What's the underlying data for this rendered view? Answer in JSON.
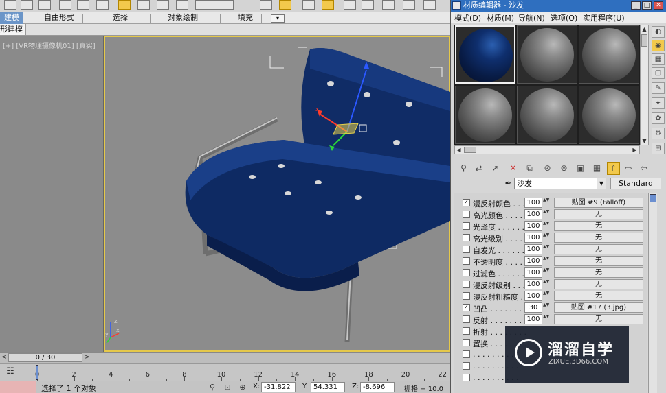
{
  "ribbon": {
    "tabs": [
      "建模",
      "自由形式",
      "选择",
      "对象绘制",
      "填充"
    ],
    "active_tab": "建模",
    "subtab": "形建模"
  },
  "viewport": {
    "label": "[+] [VR物理摄像机01] [真实]",
    "axis_labels": {
      "x": "x",
      "y": "y",
      "z": "z"
    }
  },
  "timeline": {
    "slider_text": "0 / 30",
    "prev_arrow": "<",
    "next_arrow": ">",
    "ticks": [
      0,
      2,
      4,
      6,
      8,
      10,
      12,
      14,
      16,
      18,
      20,
      22
    ]
  },
  "status": {
    "message": "选择了 1 个对象",
    "x_label": "X:",
    "x_value": "-31.822",
    "y_label": "Y:",
    "y_value": "54.331",
    "z_label": "Z:",
    "z_value": "-8.696",
    "grid": "栅格 = 10.0"
  },
  "material_editor": {
    "title": "材质编辑器 - 沙发",
    "window_buttons": {
      "minimize": "_",
      "maximize": "□",
      "close": "✕"
    },
    "menu": [
      "模式(D)",
      "材质(M)",
      "导航(N)",
      "选项(O)",
      "实用程序(U)"
    ],
    "material_name": "沙发",
    "material_type": "Standard",
    "maps": [
      {
        "checked": true,
        "label": "漫反射颜色 . . . .",
        "amount": "100",
        "map": "贴图 #9  (Falloff)"
      },
      {
        "checked": false,
        "label": "高光颜色 . . . . .",
        "amount": "100",
        "map": "无"
      },
      {
        "checked": false,
        "label": "光泽度 . . . . . .",
        "amount": "100",
        "map": "无"
      },
      {
        "checked": false,
        "label": "高光级别 . . . . .",
        "amount": "100",
        "map": "无"
      },
      {
        "checked": false,
        "label": "自发光 . . . . . .",
        "amount": "100",
        "map": "无"
      },
      {
        "checked": false,
        "label": "不透明度 . . . . .",
        "amount": "100",
        "map": "无"
      },
      {
        "checked": false,
        "label": "过滤色 . . . . . .",
        "amount": "100",
        "map": "无"
      },
      {
        "checked": false,
        "label": "漫反射级别 . . .",
        "amount": "100",
        "map": "无"
      },
      {
        "checked": false,
        "label": "漫反射粗糙度 . .",
        "amount": "100",
        "map": "无"
      },
      {
        "checked": true,
        "label": "凹凸 . . . . . . . .",
        "amount": "30",
        "map": "贴图 #17 (3.jpg)"
      },
      {
        "checked": false,
        "label": "反射 . . . . . . . .",
        "amount": "100",
        "map": "无"
      },
      {
        "checked": false,
        "label": "折射 . . . . . . . .",
        "amount": "",
        "map": ""
      },
      {
        "checked": false,
        "label": "置换 . . . . . . . .",
        "amount": "",
        "map": ""
      },
      {
        "checked": false,
        "label": ". . . . . . . . . .",
        "amount": "",
        "map": ""
      },
      {
        "checked": false,
        "label": ". . . . . . . . . .",
        "amount": "",
        "map": ""
      },
      {
        "checked": false,
        "label": ". . . . . . . . . .",
        "amount": "",
        "map": ""
      }
    ]
  },
  "watermark": {
    "title": "溜溜自学",
    "url": "ZIXUE.3D66.COM"
  },
  "colors": {
    "active_tab": "#6b95c8",
    "title_bar": "#2f6fbf",
    "viewport_border": "#e5c84a",
    "sofa": "#0f2a63",
    "active_button": "#f2c94c"
  }
}
